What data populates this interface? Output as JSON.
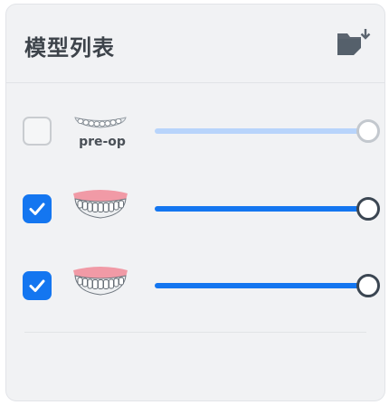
{
  "panel": {
    "title": "模型列表",
    "export_icon": "folder-export-icon"
  },
  "models": [
    {
      "label": "pre-op",
      "checked": false,
      "opacity": 1.0,
      "thumbnail": "teeth-plain-icon",
      "colors": {
        "fill": "#b8d4fb",
        "knob_border": "#c3c8ce"
      }
    },
    {
      "label": "",
      "checked": true,
      "opacity": 1.0,
      "thumbnail": "teeth-with-gums-icon",
      "colors": {
        "fill": "#1476f0",
        "knob_border": "#3b4652"
      }
    },
    {
      "label": "",
      "checked": true,
      "opacity": 1.0,
      "thumbnail": "teeth-with-gums-icon",
      "colors": {
        "fill": "#1476f0",
        "knob_border": "#3b4652"
      }
    }
  ]
}
